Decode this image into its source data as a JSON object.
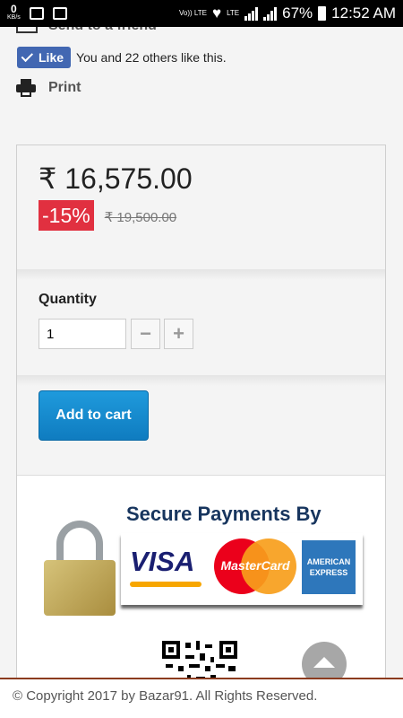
{
  "status_bar": {
    "net_speed": "0",
    "net_unit": "KB/s",
    "volte": "Vo)) LTE",
    "lte": "LTE",
    "battery": "67%",
    "time": "12:52 AM"
  },
  "share": {
    "send_label": "Send to a friend",
    "like_label": "Like",
    "like_text": "You and 22 others like this.",
    "print_label": "Print"
  },
  "product": {
    "price": "₹ 16,575.00",
    "discount": "-15%",
    "old_price": "₹ 19,500.00",
    "quantity_label": "Quantity",
    "quantity_value": "1",
    "minus_label": "−",
    "plus_label": "+",
    "add_to_cart": "Add to cart"
  },
  "payments": {
    "title": "Secure Payments By",
    "visa": "VISA",
    "mastercard": "MasterCard",
    "amex_line1": "AMERICAN",
    "amex_line2": "EXPRESS"
  },
  "footer": {
    "copyright": "© Copyright 2017 by Bazar91. All Rights Reserved."
  }
}
